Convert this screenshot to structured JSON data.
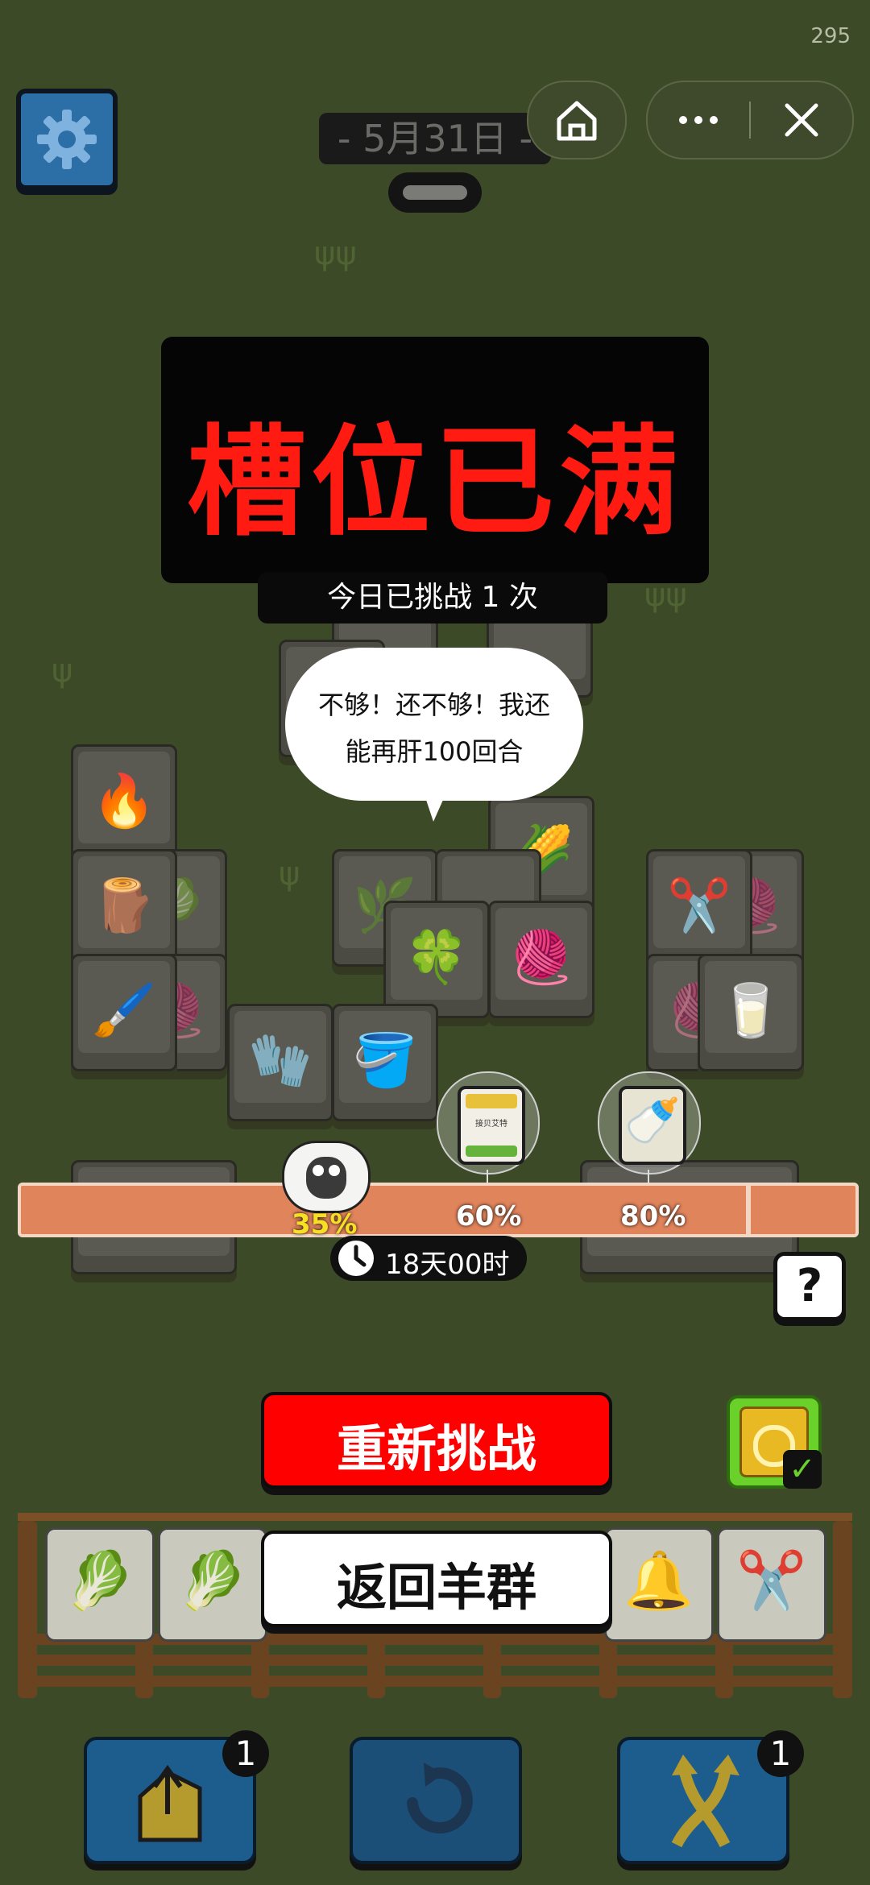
{
  "status_number": "295",
  "header": {
    "date_label": "- 5月31日 -"
  },
  "overlay": {
    "title": "槽位已满",
    "subtitle": "今日已挑战 1 次",
    "speech": [
      "不够！还不够！我还",
      "能再肝100回合"
    ]
  },
  "progress": {
    "current_percent_label": "35%",
    "current_fraction": 0.35,
    "milestones": [
      {
        "label": "60%",
        "reward_text": "接贝艾特"
      },
      {
        "label": "80%",
        "reward_text": ""
      }
    ],
    "timer": "18天00时"
  },
  "help_label": "?",
  "buttons": {
    "retry": "重新挑战",
    "back": "返回羊群"
  },
  "tool_badges": {
    "move_out": "1",
    "shuffle": "1"
  },
  "colors": {
    "background": "#3c4a27",
    "overlay_title": "#ff1a12",
    "retry_button": "#ff0000",
    "progress_bar": "#e0845c"
  }
}
